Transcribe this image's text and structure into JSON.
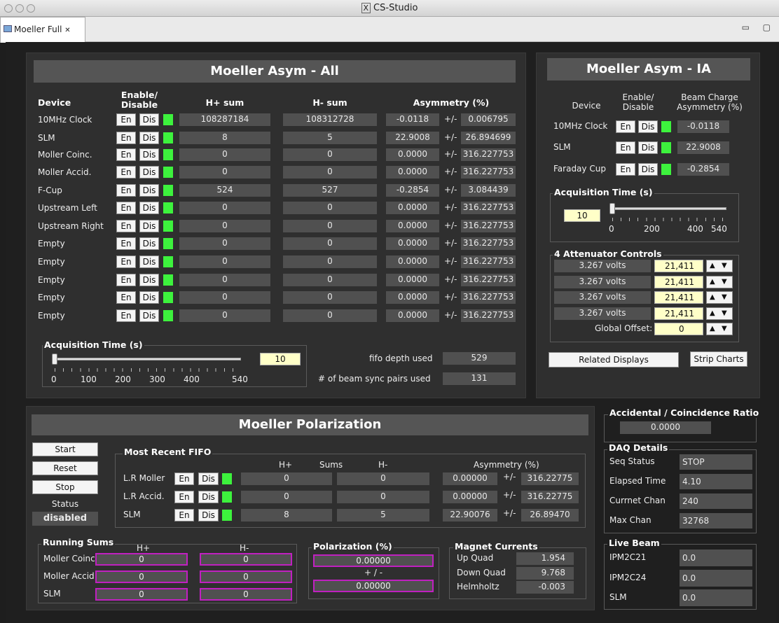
{
  "window": {
    "title": "CS-Studio",
    "tab_label": "Moeller Full"
  },
  "asym_all": {
    "title": "Moeller Asym - All",
    "col_device": "Device",
    "col_enable": "Enable/",
    "col_enable2": "Disable",
    "col_hplus": "H+ sum",
    "col_hminus": "H- sum",
    "col_asym": "Asymmetry (%)",
    "btn_en": "En",
    "btn_dis": "Dis",
    "pm": "+/-",
    "rows": [
      {
        "device": "10MHz Clock",
        "hplus": "108287184",
        "hminus": "108312728",
        "asym": "-0.0118",
        "err": "0.006795"
      },
      {
        "device": "SLM",
        "hplus": "8",
        "hminus": "5",
        "asym": "22.9008",
        "err": "26.894699"
      },
      {
        "device": "Moller Coinc.",
        "hplus": "0",
        "hminus": "0",
        "asym": "0.0000",
        "err": "316.227753"
      },
      {
        "device": "Moller Accid.",
        "hplus": "0",
        "hminus": "0",
        "asym": "0.0000",
        "err": "316.227753"
      },
      {
        "device": "F-Cup",
        "hplus": "524",
        "hminus": "527",
        "asym": "-0.2854",
        "err": "3.084439"
      },
      {
        "device": "Upstream Left",
        "hplus": "0",
        "hminus": "0",
        "asym": "0.0000",
        "err": "316.227753"
      },
      {
        "device": "Upstream Right",
        "hplus": "0",
        "hminus": "0",
        "asym": "0.0000",
        "err": "316.227753"
      },
      {
        "device": "Empty",
        "hplus": "0",
        "hminus": "0",
        "asym": "0.0000",
        "err": "316.227753"
      },
      {
        "device": "Empty",
        "hplus": "0",
        "hminus": "0",
        "asym": "0.0000",
        "err": "316.227753"
      },
      {
        "device": "Empty",
        "hplus": "0",
        "hminus": "0",
        "asym": "0.0000",
        "err": "316.227753"
      },
      {
        "device": "Empty",
        "hplus": "0",
        "hminus": "0",
        "asym": "0.0000",
        "err": "316.227753"
      },
      {
        "device": "Empty",
        "hplus": "0",
        "hminus": "0",
        "asym": "0.0000",
        "err": "316.227753"
      }
    ],
    "acq_title": "Acquisition Time (s)",
    "acq_value": "10",
    "acq_ticks": [
      "0",
      "100",
      "200",
      "300",
      "400",
      "540"
    ],
    "fifo_label": "fifo depth used",
    "fifo_value": "529",
    "pairs_label": "# of beam sync pairs used",
    "pairs_value": "131"
  },
  "asym_ia": {
    "title": "Moeller Asym - IA",
    "col_device": "Device",
    "col_enable": "Enable/",
    "col_enable2": "Disable",
    "col_bc": "Beam Charge",
    "col_bc2": "Asymmetry (%)",
    "rows": [
      {
        "device": "10MHz Clock",
        "value": "-0.0118"
      },
      {
        "device": "SLM",
        "value": "22.9008"
      },
      {
        "device": "Faraday Cup",
        "value": "-0.2854"
      }
    ],
    "acq_title": "Acquisition Time (s)",
    "acq_value": "10",
    "acq_ticks": [
      "0",
      "200",
      "400",
      "540"
    ],
    "atten_title": "4 Attenuator Controls",
    "atten": [
      {
        "volts": "3.267 volts",
        "value": "21,411"
      },
      {
        "volts": "3.267 volts",
        "value": "21,411"
      },
      {
        "volts": "3.267 volts",
        "value": "21,411"
      },
      {
        "volts": "3.267 volts",
        "value": "21,411"
      }
    ],
    "global_label": "Global Offset:",
    "global_value": "0",
    "related_btn": "Related Displays",
    "strip_btn": "Strip Charts"
  },
  "polarization": {
    "title": "Moeller Polarization",
    "start": "Start",
    "reset": "Reset",
    "stop": "Stop",
    "status_label": "Status",
    "status_value": "disabled",
    "fifo_title": "Most Recent FIFO",
    "col_hplus": "H+",
    "col_sums": "Sums",
    "col_hminus": "H-",
    "col_asym": "Asymmetry (%)",
    "fifo_rows": [
      {
        "label": "L.R Moller",
        "hplus": "0",
        "hminus": "0",
        "asym": "0.00000",
        "err": "316.22775"
      },
      {
        "label": "L.R Accid.",
        "hplus": "0",
        "hminus": "0",
        "asym": "0.00000",
        "err": "316.22775"
      },
      {
        "label": "SLM",
        "hplus": "8",
        "hminus": "5",
        "asym": "22.90076",
        "err": "26.89470"
      }
    ],
    "running_title": "Running Sums",
    "rs_hplus": "H+",
    "rs_hminus": "H-",
    "running": [
      {
        "label": "Moller Coinc",
        "hplus": "0",
        "hminus": "0"
      },
      {
        "label": "Moller Accid",
        "hplus": "0",
        "hminus": "0"
      },
      {
        "label": "SLM",
        "hplus": "0",
        "hminus": "0"
      }
    ],
    "pol_title": "Polarization (%)",
    "pol_value": "0.00000",
    "pol_pm": "+ / -",
    "pol_err": "0.00000",
    "mag_title": "Magnet Currents",
    "magnets": [
      {
        "label": "Up Quad",
        "value": "1.954"
      },
      {
        "label": "Down Quad",
        "value": "9.768"
      },
      {
        "label": "Helmholtz",
        "value": "-0.003"
      }
    ]
  },
  "side": {
    "ratio_title": "Accidental / Coincidence Ratio",
    "ratio_value": "0.0000",
    "daq_title": "DAQ Details",
    "daq": [
      {
        "label": "Seq Status",
        "value": "STOP"
      },
      {
        "label": "Elapsed Time",
        "value": "4.10"
      },
      {
        "label": "Currnet Chan",
        "value": "240"
      },
      {
        "label": "Max Chan",
        "value": "32768"
      }
    ],
    "beam_title": "Live Beam",
    "beam": [
      {
        "label": "IPM2C21",
        "value": "0.0"
      },
      {
        "label": "IPM2C24",
        "value": "0.0"
      },
      {
        "label": "SLM",
        "value": "0.0"
      }
    ]
  },
  "colors": {
    "led_on": "#3df23d",
    "highlight": "#ffffc8",
    "magenta_border": "#c020c0"
  }
}
